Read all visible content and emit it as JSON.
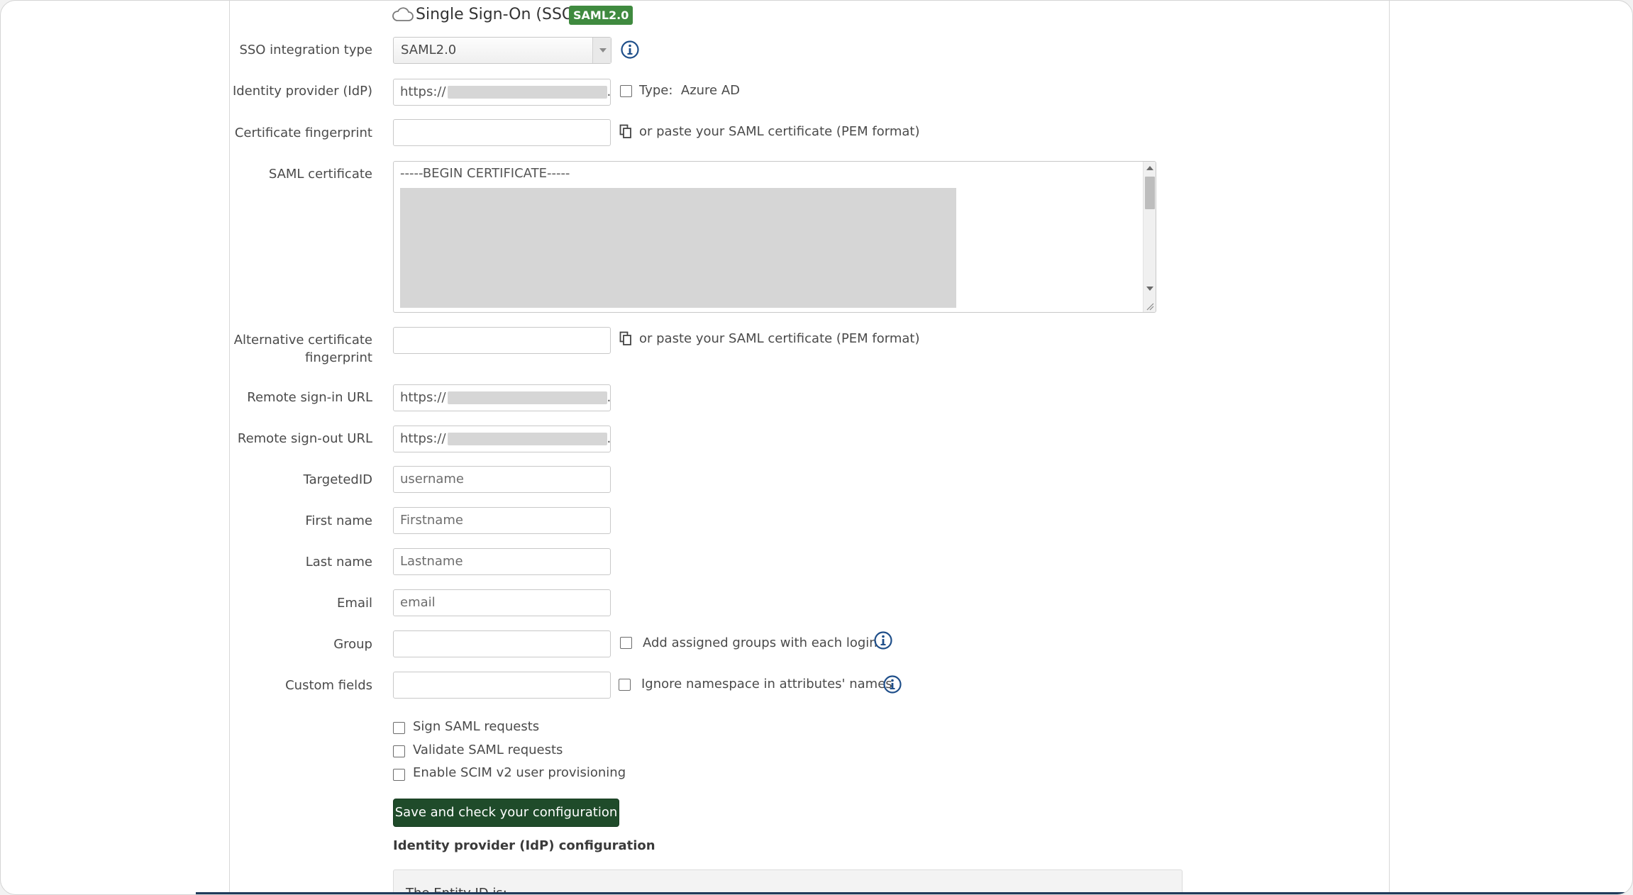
{
  "header": {
    "title": "Single Sign-On (SSO)",
    "badge": "SAML2.0",
    "icon": "cloud-icon"
  },
  "form": {
    "integration_type": {
      "label": "SSO integration type",
      "value": "SAML2.0"
    },
    "idp": {
      "label": "Identity provider (IdP)",
      "value_prefix": "https://",
      "value_suffix": ".",
      "type_checkbox_label": "Type:",
      "type_value": "Azure AD"
    },
    "cert_fingerprint": {
      "label": "Certificate fingerprint",
      "value": "",
      "paste_hint": "or paste your SAML certificate (PEM format)"
    },
    "saml_certificate": {
      "label": "SAML certificate",
      "first_line": "-----BEGIN CERTIFICATE-----"
    },
    "alt_fingerprint": {
      "label": "Alternative certificate fingerprint",
      "value": "",
      "paste_hint": "or paste your SAML certificate (PEM format)"
    },
    "remote_signin": {
      "label": "Remote sign-in URL",
      "value_prefix": "https://",
      "value_suffix": "."
    },
    "remote_signout": {
      "label": "Remote sign-out URL",
      "value_prefix": "https://",
      "value_suffix": "."
    },
    "targeted_id": {
      "label": "TargetedID",
      "placeholder": "username"
    },
    "first_name": {
      "label": "First name",
      "placeholder": "Firstname"
    },
    "last_name": {
      "label": "Last name",
      "placeholder": "Lastname"
    },
    "email": {
      "label": "Email",
      "placeholder": "email"
    },
    "group": {
      "label": "Group",
      "value": "",
      "checkbox_label": "Add assigned groups with each login",
      "checked": false
    },
    "custom_fields": {
      "label": "Custom fields",
      "value": "",
      "checkbox_label": "Ignore namespace in attributes' names",
      "checked": false
    },
    "options": [
      {
        "label": "Sign SAML requests",
        "checked": false
      },
      {
        "label": "Validate SAML requests",
        "checked": false
      },
      {
        "label": "Enable SCIM v2 user provisioning",
        "checked": false
      }
    ],
    "save_button": "Save and check your configuration",
    "idp_config_title": "Identity provider (IdP) configuration",
    "entity_id_label": "The Entity ID is:"
  },
  "colors": {
    "badge": "#3f8a3f",
    "save_button": "#1f4b2a",
    "info_icon": "#1f4f8a"
  }
}
